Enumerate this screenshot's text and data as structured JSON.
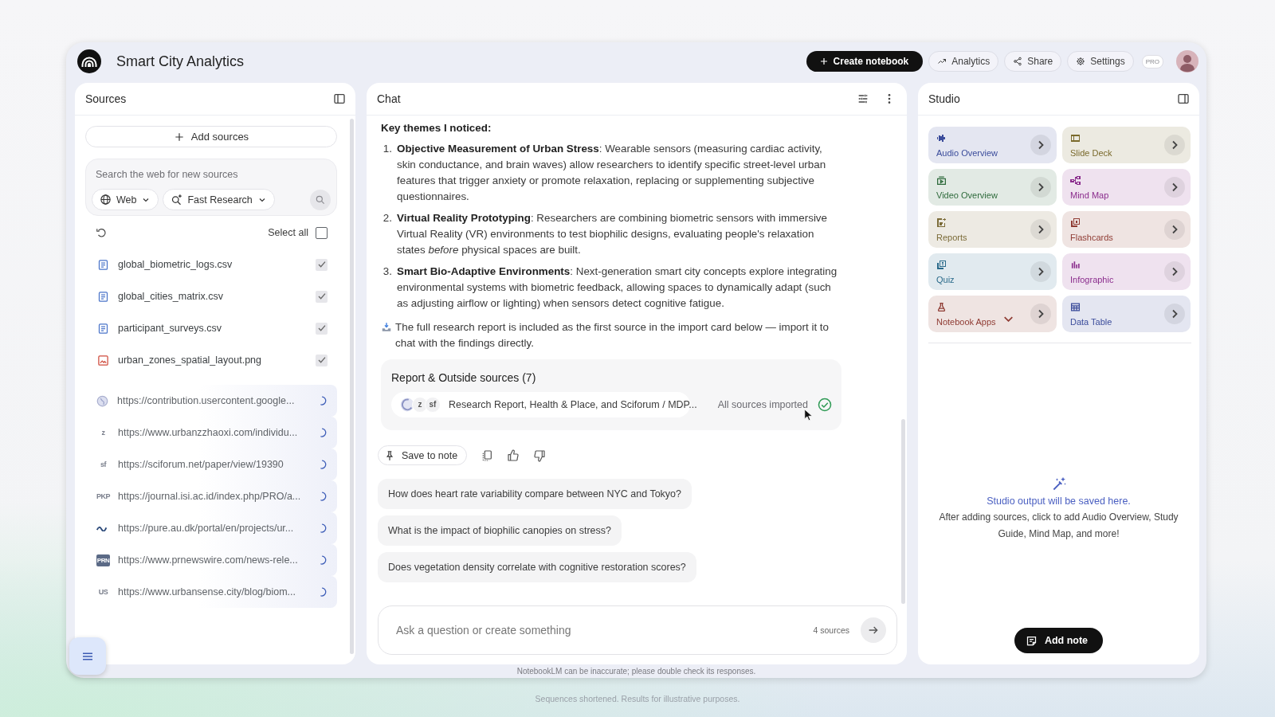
{
  "window": {
    "title": "Smart City Analytics"
  },
  "header_actions": [
    {
      "kind": "create",
      "label": "Create notebook"
    },
    {
      "kind": "analytics",
      "label": "Analytics"
    },
    {
      "kind": "share",
      "label": "Share"
    },
    {
      "kind": "settings",
      "label": "Settings"
    }
  ],
  "plan_badge": "PRO",
  "sources": {
    "title": "Sources",
    "add_button": "Add sources",
    "search": {
      "placeholder": "Search the web for new sources",
      "scope": "Web",
      "mode": "Fast Research"
    },
    "select_all": {
      "label": "Select all",
      "checked": false
    },
    "files": [
      {
        "kind": "document",
        "name": "global_biometric_logs.csv",
        "checked": true
      },
      {
        "kind": "document",
        "name": "global_cities_matrix.csv",
        "checked": true
      },
      {
        "kind": "document",
        "name": "participant_surveys.csv",
        "checked": true
      },
      {
        "kind": "image",
        "name": "urban_zones_spatial_layout.png",
        "checked": true
      }
    ],
    "links": [
      {
        "kind": "globe",
        "url": "https://contribution.usercontent.google...",
        "loading": true
      },
      {
        "kind": "letters",
        "logo": "z",
        "url": "https://www.urbanzzhaoxi.com/individu...",
        "loading": true
      },
      {
        "kind": "letters",
        "logo": "sf",
        "url": "https://sciforum.net/paper/view/19390",
        "loading": true
      },
      {
        "kind": "letters",
        "logo": "PKP",
        "url": "https://journal.isi.ac.id/index.php/PRO/a...",
        "loading": true
      },
      {
        "kind": "wave",
        "url": "https://pure.au.dk/portal/en/projects/ur...",
        "loading": true
      },
      {
        "kind": "boxed",
        "logo": "PRN",
        "url": "https://www.prnewswire.com/news-rele...",
        "loading": true
      },
      {
        "kind": "letters",
        "logo": "US",
        "url": "https://www.urbansense.city/blog/biom...",
        "loading": true
      }
    ]
  },
  "chat": {
    "title": "Chat",
    "heading": "Key themes I noticed:",
    "points": [
      {
        "number": "1.",
        "text": "**Objective Measurement of Urban Stress**: Wearable sensors (measuring cardiac activity, skin conductance, and brain waves) allow researchers to identify specific street-level urban features that trigger anxiety or promote relaxation, replacing or supplementing subjective questionnaires."
      },
      {
        "number": "2.",
        "text": "**Virtual Reality Prototyping**: Researchers are combining biometric sensors with immersive Virtual Reality (VR) environments to test biophilic designs, evaluating people's relaxation states *before* physical spaces are built."
      },
      {
        "number": "3.",
        "text": "**Smart Bio-Adaptive Environments**: Next-generation smart city concepts explore integrating environmental systems with biometric feedback, allowing spaces to dynamically adapt (such as adjusting airflow or lighting) when sensors detect cognitive fatigue."
      }
    ],
    "note": "The full research report is included as the first source in the import card below — import it to chat with the findings directly.",
    "import_card": {
      "title": "Report & Outside sources (7)",
      "logos": [
        {
          "kind": "globe"
        },
        {
          "kind": "letters",
          "text": "z"
        },
        {
          "kind": "letters",
          "text": "sf"
        }
      ],
      "summary": "Research Report, Health & Place, and Sciforum / MDP...",
      "status": "All sources imported",
      "imported": true
    },
    "save_button": "Save to note",
    "suggestions": [
      "How does heart rate variability compare between NYC and Tokyo?",
      "What is the impact of biophilic canopies on stress?",
      "Does vegetation density correlate with cognitive restoration scores?"
    ],
    "input": {
      "placeholder": "Ask a question or create something",
      "source_count": "4 sources"
    }
  },
  "studio": {
    "title": "Studio",
    "tiles": [
      {
        "kind": "audio",
        "label": "Audio Overview",
        "color": "#3b4c9b",
        "has_menu": false
      },
      {
        "kind": "slides",
        "label": "Slide Deck",
        "color": "#7a6a2c",
        "has_menu": false
      },
      {
        "kind": "video",
        "label": "Video Overview",
        "color": "#2f6b3c",
        "has_menu": false
      },
      {
        "kind": "mindmap",
        "label": "Mind Map",
        "color": "#8b2d8d",
        "has_menu": false
      },
      {
        "kind": "report",
        "label": "Reports",
        "color": "#7b6b38",
        "has_menu": false
      },
      {
        "kind": "flashcards",
        "label": "Flashcards",
        "color": "#8f3b33",
        "has_menu": false
      },
      {
        "kind": "quiz",
        "label": "Quiz",
        "color": "#2a6a8a",
        "has_menu": false
      },
      {
        "kind": "infographic",
        "label": "Infographic",
        "color": "#8b2d8d",
        "has_menu": false
      },
      {
        "kind": "apps",
        "label": "Notebook Apps",
        "color": "#8f3b33",
        "has_menu": true
      },
      {
        "kind": "table",
        "label": "Data Table",
        "color": "#3b4c9b",
        "has_menu": false
      }
    ],
    "empty_title": "Studio output will be saved here.",
    "empty_text": "After adding sources, click to add Audio Overview, Study Guide, Mind Map, and more!",
    "add_note": "Add note"
  },
  "disclaimer": "NotebookLM can be inaccurate; please double check its responses.",
  "caption": "Sequences shortened. Results for illustrative purposes."
}
